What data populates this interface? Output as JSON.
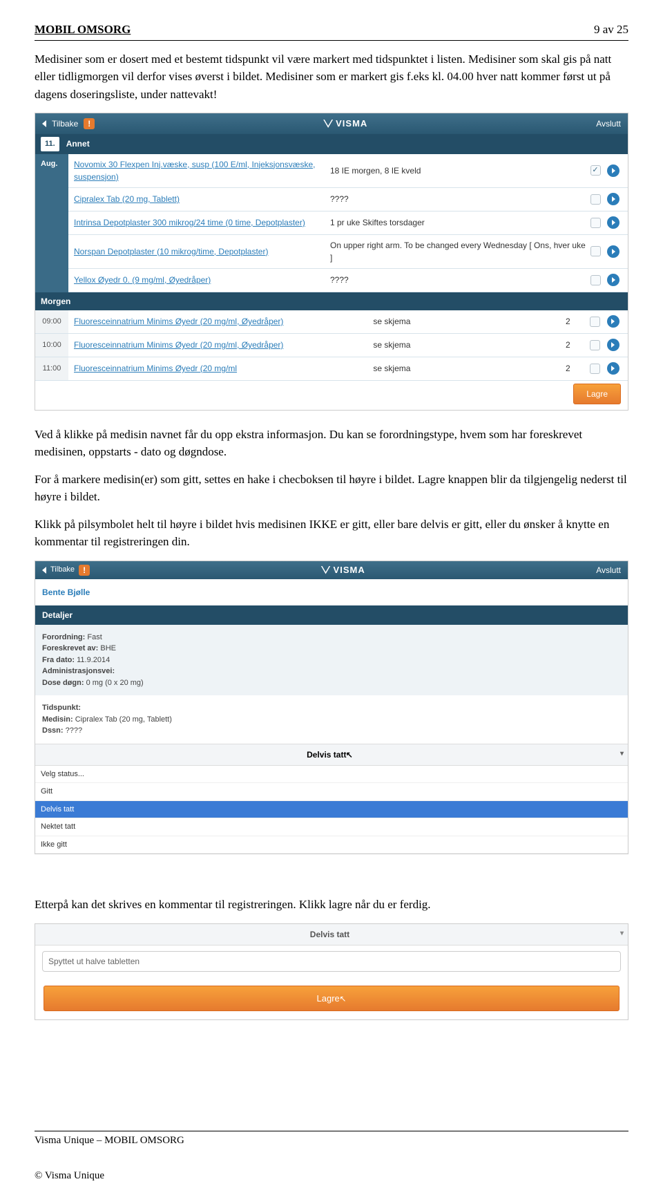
{
  "header": {
    "title": "MOBIL OMSORG",
    "page": "9 av 25"
  },
  "p1": "Medisiner som er dosert med et bestemt tidspunkt vil være markert med tidspunktet i listen. Medisiner som skal gis på natt eller tidligmorgen vil derfor vises øverst i bildet. Medisiner som er markert gis f.eks kl. 04.00 hver natt kommer først ut på dagens doseringsliste, under nattevakt!",
  "shot1": {
    "back": "Tilbake",
    "logo": "VISMA",
    "end": "Avslutt",
    "num": "11.",
    "annet": "Annet",
    "aug": "Aug.",
    "rows": [
      {
        "name": "Novomix 30 Flexpen Inj.væske, susp (100 E/ml, Injeksjonsvæske, suspensjon)",
        "note": "18 IE morgen, 8 IE kveld",
        "checked": true
      },
      {
        "name": "Cipralex Tab (20 mg, Tablett)",
        "note": "????",
        "checked": false
      },
      {
        "name": "Intrinsa Depotplaster 300 mikrog/24 time (0 time, Depotplaster)",
        "note": "1 pr uke Skiftes torsdager",
        "checked": false
      },
      {
        "name": "Norspan Depotplaster (10 mikrog/time, Depotplaster)",
        "note": "On upper right arm. To be changed every Wednesday [ Ons, hver uke ]",
        "checked": false
      },
      {
        "name": "Yellox Øyedr 0. (9 mg/ml, Øyedråper)",
        "note": "????",
        "checked": false
      }
    ],
    "morgen": "Morgen",
    "rows2": [
      {
        "t": "09:00",
        "name": "Fluoresceinnatrium Minims Øyedr (20 mg/ml, Øyedråper)",
        "note": "se skjema",
        "n": "2"
      },
      {
        "t": "10:00",
        "name": "Fluoresceinnatrium Minims Øyedr (20 mg/ml, Øyedråper)",
        "note": "se skjema",
        "n": "2"
      },
      {
        "t": "11:00",
        "name": "Fluoresceinnatrium Minims Øyedr (20 mg/ml",
        "note": "se skjema",
        "n": "2"
      }
    ],
    "lagre": "Lagre"
  },
  "p2": "Ved å klikke på medisin navnet får du opp ekstra informasjon. Du kan se forordningstype, hvem som har foreskrevet medisinen, oppstarts - dato og døgndose.",
  "p3": "For å markere medisin(er) som gitt, settes en hake i checboksen til høyre i bildet. Lagre knappen blir da tilgjengelig nederst til høyre i bildet.",
  "p4": "Klikk på pilsymbolet helt til høyre i bildet hvis medisinen IKKE er gitt, eller bare delvis er gitt, eller du ønsker å knytte en kommentar til registreringen din.",
  "shot2": {
    "back": "Tilbake",
    "logo": "VISMA",
    "end": "Avslutt",
    "patient": "Bente Bjølle",
    "det": "Detaljer",
    "meta": [
      {
        "k": "Forordning:",
        "v": "Fast"
      },
      {
        "k": "Foreskrevet av:",
        "v": "BHE"
      },
      {
        "k": "Fra dato:",
        "v": "11.9.2014"
      },
      {
        "k": "Administrasjonsvei:",
        "v": ""
      },
      {
        "k": "Dose døgn:",
        "v": "0 mg (0 x 20 mg)"
      }
    ],
    "info": [
      {
        "k": "Tidspunkt:",
        "v": ""
      },
      {
        "k": "Medisin:",
        "v": "Cipralex Tab (20 mg, Tablett)"
      },
      {
        "k": "Dssn:",
        "v": "????"
      }
    ],
    "selectLabel": "Delvis tatt",
    "opts": [
      "Velg status...",
      "Gitt",
      "Delvis tatt",
      "Nektet tatt",
      "Ikke gitt"
    ],
    "selected": "Delvis tatt"
  },
  "p5": "Etterpå kan det skrives en kommentar til registreringen. Klikk lagre når du er ferdig.",
  "shot3": {
    "hdr": "Delvis tatt",
    "comment": "Spyttet ut halve tabletten",
    "btn": "Lagre"
  },
  "footer": {
    "line": "Visma Unique – MOBIL OMSORG",
    "copy": "© Visma Unique"
  }
}
